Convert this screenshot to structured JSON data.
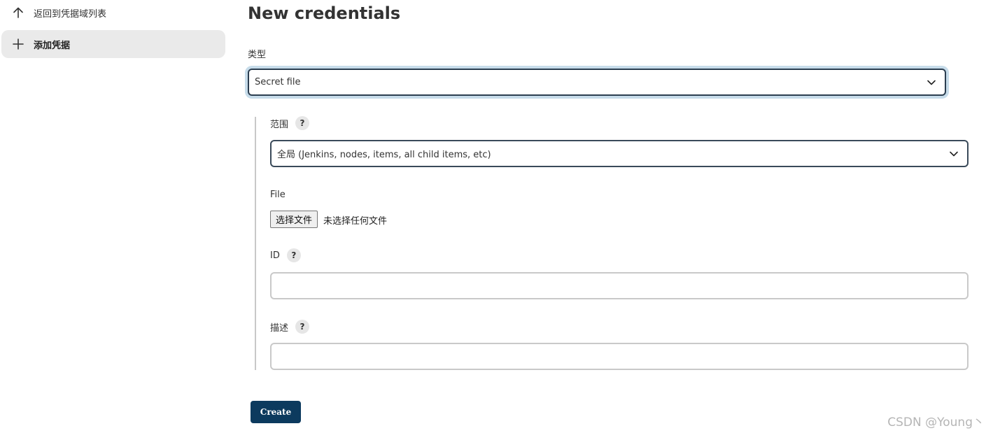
{
  "sidebar": {
    "back_label": "返回到凭据域列表",
    "add_label": "添加凭据"
  },
  "main": {
    "title": "New credentials",
    "type": {
      "label": "类型",
      "selected": "Secret file"
    },
    "scope": {
      "label": "范围",
      "help": "?",
      "selected": "全局 (Jenkins, nodes, items, all child items, etc)"
    },
    "file": {
      "label": "File",
      "button_label": "选择文件",
      "status": "未选择任何文件"
    },
    "id": {
      "label": "ID",
      "help": "?",
      "value": ""
    },
    "description": {
      "label": "描述",
      "help": "?",
      "value": ""
    },
    "create_label": "Create"
  },
  "watermark": "CSDN @Young丶",
  "colors": {
    "primary_button": "#0c3a5e",
    "focus_ring": "#c7dcea",
    "sidebar_active": "#eaeaea"
  }
}
